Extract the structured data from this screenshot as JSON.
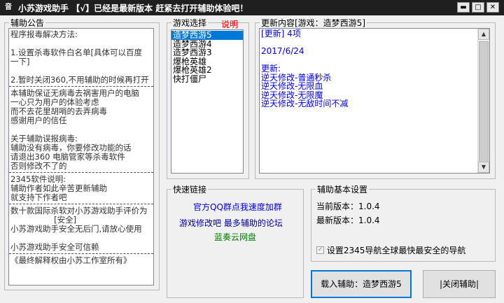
{
  "window": {
    "app_icon": "⾳",
    "title": "小苏游戏助手 【√】已经是最新版本 赶紧去打开辅助体验吧！",
    "min": "▬",
    "max": "□",
    "close": "✕"
  },
  "notice": {
    "legend": "辅助公告",
    "lines": [
      {
        "t": "程序报毒解决方法:"
      },
      {
        "t": ""
      },
      {
        "t": "1.设置杀毒软件白名单[具体可以百度"
      },
      {
        "t": "一下]"
      },
      {
        "t": ""
      },
      {
        "t": "2.暂时关闭360,不用辅助的时候再打开"
      },
      {
        "sep": true
      },
      {
        "t": "本辅助保证无病毒去祸害用户的电脑"
      },
      {
        "t": "一心只为用户的体验考虑"
      },
      {
        "t": "而不去花里胡哨的去弄病毒"
      },
      {
        "t": "感谢用户的信任"
      },
      {
        "t": ""
      },
      {
        "t": "关于辅助误报病毒:"
      },
      {
        "t": "辅助没有病毒，你要修改功能的话"
      },
      {
        "t": "请退出360 电脑管家等杀毒软件"
      },
      {
        "t": "否则修改不了的"
      },
      {
        "sep": true
      },
      {
        "t": "2345软件说明:"
      },
      {
        "t": "辅助作者如此辛苦更新辅助"
      },
      {
        "t": "就支持下作者吧"
      },
      {
        "sep": true
      },
      {
        "t": "数十款国际杀软对小苏游戏助手评价为"
      },
      {
        "t": "                 [安全]"
      },
      {
        "t": "小苏游戏助手安全无后门,请放心使用"
      },
      {
        "t": ""
      },
      {
        "t": "小苏游戏助手安全可信赖"
      },
      {
        "sep": true
      },
      {
        "t": "《最终解释权由小苏工作室所有》"
      }
    ]
  },
  "games": {
    "legend": "游戏选择",
    "help_label": "说明",
    "items": [
      "造梦西游5",
      "造梦西游4",
      "造梦西游3",
      "爆枪英雄",
      "爆枪英雄2",
      "快打僵尸"
    ],
    "selected_index": 0
  },
  "updates": {
    "legend": "更新内容[游戏：造梦西游5]",
    "lines": [
      "[更新] 4项",
      "",
      "2017/6/24",
      "",
      "更新:",
      "逆天修改-普通秒杀",
      "逆天修改-无限血",
      "逆天修改-无限魔",
      "逆天修改-无敌时间不减"
    ]
  },
  "quick_links": {
    "legend": "快速链接",
    "qq_group": "官方QQ群点我速度加群",
    "forum": "游戏修改吧  最多辅助的论坛",
    "cloud": "蓝奏云网盘",
    "colors": {
      "qq": "#0000ff",
      "forum": "#0000a0",
      "cloud": "#008000"
    }
  },
  "settings": {
    "legend": "辅助基本设置",
    "current_version": "当前版本：1.0.4",
    "latest_version": "最新版本：1.0.4",
    "checkbox_label": "设置2345导航全球最快最安全的导航",
    "checkbox_checked": true
  },
  "buttons": {
    "load": "载入辅助：造梦西游5",
    "close": "|关闭辅助|"
  }
}
